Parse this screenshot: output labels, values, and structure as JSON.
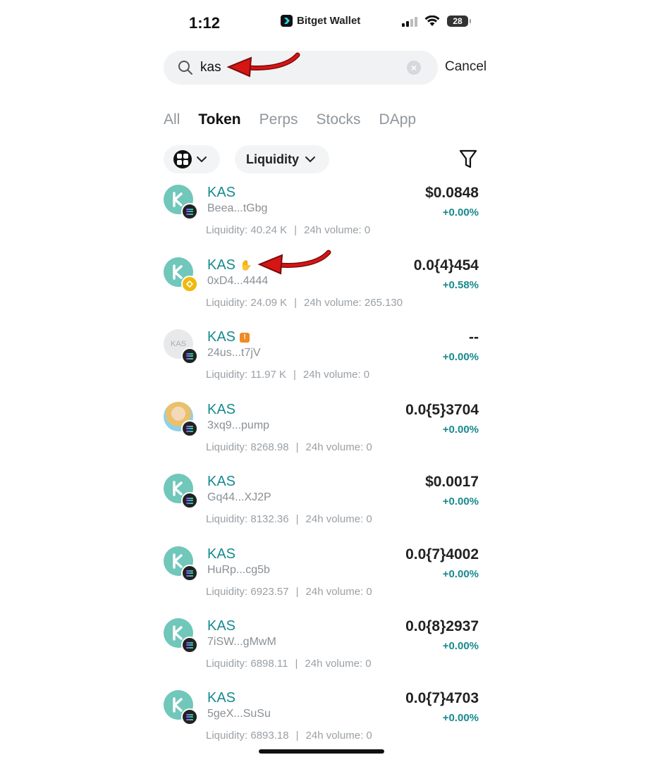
{
  "status_bar": {
    "time": "1:12",
    "app_name": "Bitget Wallet",
    "battery": "28"
  },
  "search": {
    "value": "kas",
    "cancel_label": "Cancel"
  },
  "tabs": [
    {
      "label": "All",
      "active": false
    },
    {
      "label": "Token",
      "active": true
    },
    {
      "label": "Perps",
      "active": false
    },
    {
      "label": "Stocks",
      "active": false
    },
    {
      "label": "DApp",
      "active": false
    }
  ],
  "filters": {
    "sort_label": "Liquidity"
  },
  "labels": {
    "liquidity": "Liquidity:",
    "volume": "24h volume:"
  },
  "tokens": [
    {
      "symbol": "KAS",
      "address": "Beea...tGbg",
      "price": "$0.0848",
      "change": "+0.00%",
      "liquidity": "40.24 K",
      "volume": "0",
      "chain": "solana-icon"
    },
    {
      "symbol": "KAS",
      "address": "0xD4...4444",
      "price": "0.0{4}454",
      "change": "+0.58%",
      "liquidity": "24.09 K",
      "volume": "265.130",
      "chain": "bnb-icon"
    },
    {
      "symbol": "KAS",
      "address": "24us...t7jV",
      "price": "--",
      "change": "+0.00%",
      "liquidity": "11.97 K",
      "volume": "0",
      "chain": "solana-icon",
      "avatar_text": "KAS"
    },
    {
      "symbol": "KAS",
      "address": "3xq9...pump",
      "price": "0.0{5}3704",
      "change": "+0.00%",
      "liquidity": "8268.98",
      "volume": "0",
      "chain": "solana-icon"
    },
    {
      "symbol": "KAS",
      "address": "Gq44...XJ2P",
      "price": "$0.0017",
      "change": "+0.00%",
      "liquidity": "8132.36",
      "volume": "0",
      "chain": "solana-icon"
    },
    {
      "symbol": "KAS",
      "address": "HuRp...cg5b",
      "price": "0.0{7}4002",
      "change": "+0.00%",
      "liquidity": "6923.57",
      "volume": "0",
      "chain": "solana-icon"
    },
    {
      "symbol": "KAS",
      "address": "7iSW...gMwM",
      "price": "0.0{8}2937",
      "change": "+0.00%",
      "liquidity": "6898.11",
      "volume": "0",
      "chain": "solana-icon"
    },
    {
      "symbol": "KAS",
      "address": "5geX...SuSu",
      "price": "0.0{7}4703",
      "change": "+0.00%",
      "liquidity": "6893.18",
      "volume": "0",
      "chain": "solana-icon"
    }
  ]
}
